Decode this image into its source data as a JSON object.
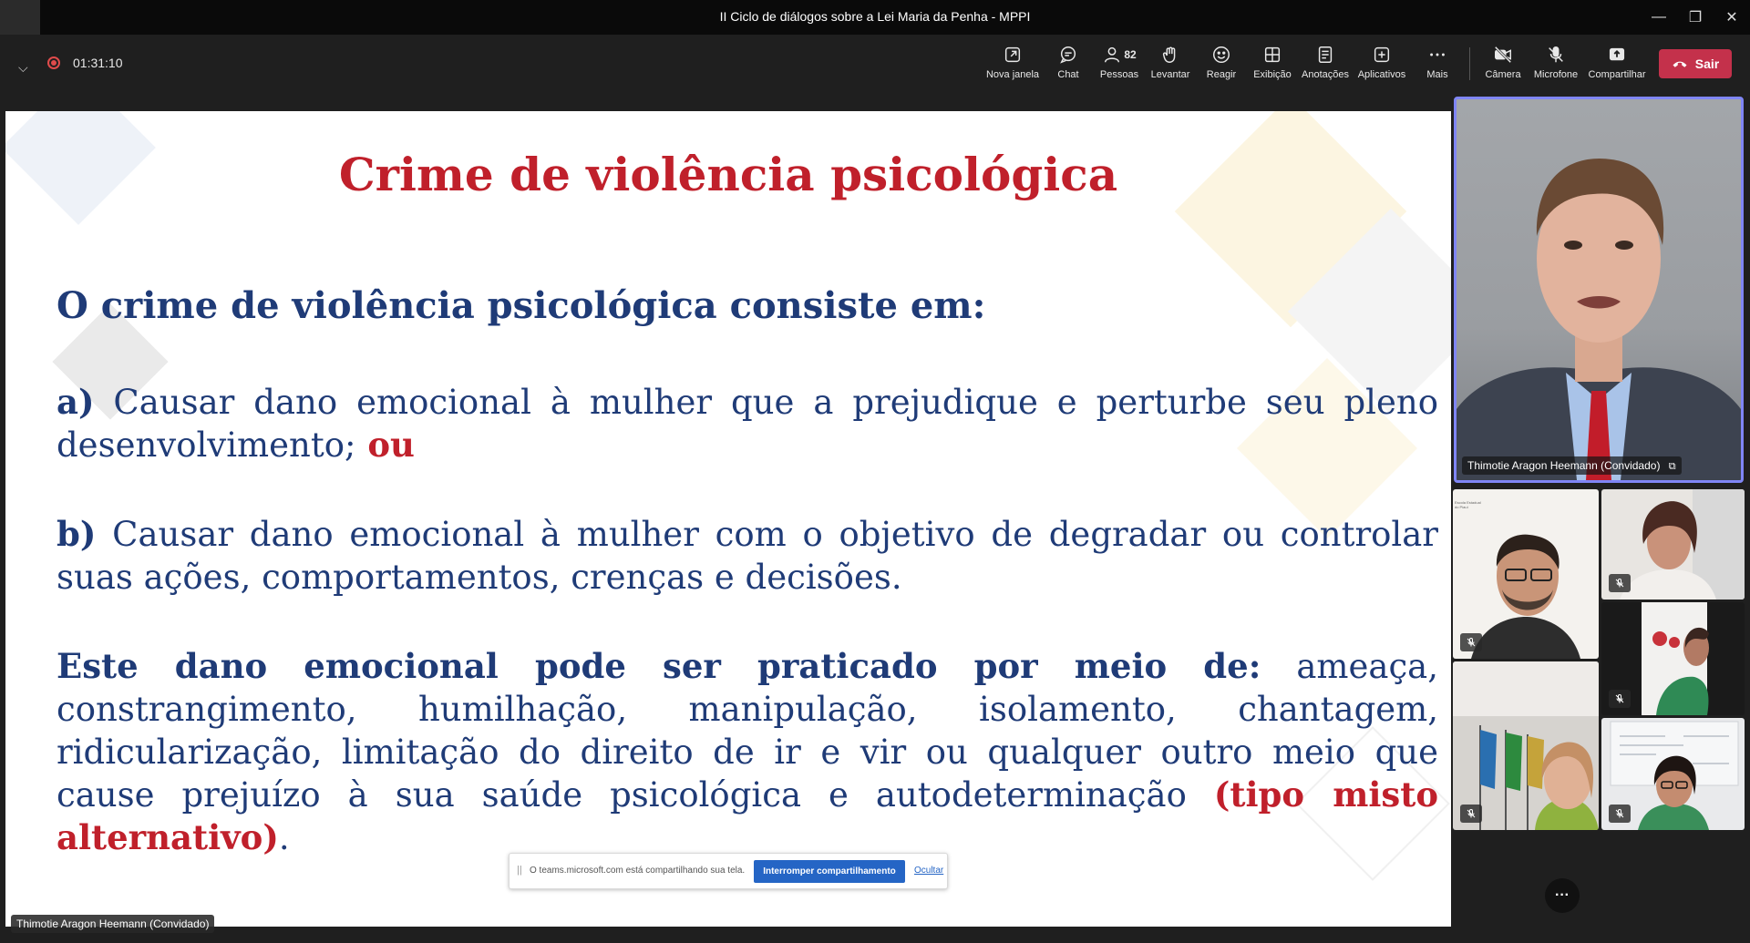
{
  "window": {
    "title": "II Ciclo de diálogos sobre a Lei Maria da Penha - MPPI",
    "minimize": "—",
    "restore": "❐",
    "close": "✕"
  },
  "toolbar": {
    "timer": "01:31:10",
    "items": [
      {
        "label": "Nova janela",
        "icon": "new-window-icon"
      },
      {
        "label": "Chat",
        "icon": "chat-icon"
      },
      {
        "label": "Pessoas",
        "icon": "people-icon",
        "count": "82"
      },
      {
        "label": "Levantar",
        "icon": "raise-hand-icon"
      },
      {
        "label": "Reagir",
        "icon": "react-icon"
      },
      {
        "label": "Exibição",
        "icon": "view-icon"
      },
      {
        "label": "Anotações",
        "icon": "notes-icon"
      },
      {
        "label": "Aplicativos",
        "icon": "apps-icon"
      },
      {
        "label": "Mais",
        "icon": "more-icon"
      },
      {
        "label": "Câmera",
        "icon": "camera-off-icon"
      },
      {
        "label": "Microfone",
        "icon": "mic-off-icon"
      },
      {
        "label": "Compartilhar",
        "icon": "share-icon"
      }
    ],
    "leave_label": "Sair",
    "leave_color": "#c4314b"
  },
  "slide": {
    "title": "Crime de violência psicológica",
    "heading": "O crime de violência psicológica consiste em:",
    "item_a_prefix": "a)",
    "item_a_text": " Causar dano emocional à mulher que a prejudique e perturbe seu pleno desenvolvimento;",
    "item_a_suffix": " ou",
    "item_b_prefix": "b)",
    "item_b_text": " Causar dano emocional à mulher com o objetivo de degradar ou controlar suas ações, comportamentos, crenças e decisões.",
    "item_c_bold": "Este dano emocional pode ser praticado por meio de:",
    "item_c_text": " ameaça, constrangimento, humilhação, manipulação, isolamento, chantagem, ridicularização, limitação do direito de ir e vir ou qualquer outro meio que cause prejuízo à sua saúde psicológica e autodeterminação ",
    "item_c_red": "(tipo misto alternativo)",
    "item_c_end": ".",
    "title_color": "#c0202b",
    "text_color": "#1f3b77"
  },
  "share_bar": {
    "grip": "||",
    "message": "O teams.microsoft.com está compartilhando sua tela.",
    "stop_label": "Interromper compartilhamento",
    "hide_label": "Ocultar"
  },
  "presenter_name": "Thimotie Aragon Heemann (Convidado)",
  "speaker_name": "Thimotie Aragon Heemann (Convidado)",
  "tiles": {
    "tile1_logo_text": "Escola Estadual do Piauí"
  },
  "more_button": "···"
}
